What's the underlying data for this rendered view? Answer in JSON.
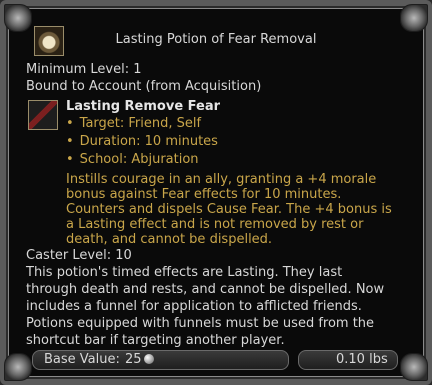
{
  "item": {
    "title": "Lasting Potion of Fear Removal",
    "minimum_level": "Minimum Level: 1",
    "binding": "Bound to Account (from Acquisition)",
    "icon": "potion-icon"
  },
  "spell": {
    "name": "Lasting Remove Fear",
    "icon": "remove-fear-icon",
    "bullets": [
      "Target: Friend, Self",
      "Duration: 10 minutes",
      "School: Abjuration"
    ],
    "description_lines": [
      "Instills courage in an ally, granting a +4 morale",
      "bonus against Fear effects for 10 minutes.",
      "Counters and dispels Cause Fear. The +4 bonus is",
      "a Lasting effect and is not removed by rest or",
      "death, and cannot be dispelled."
    ]
  },
  "caster_level": "Caster Level: 10",
  "info_lines": [
    "This potion's timed effects are Lasting. They last",
    "through death and rests, and cannot be dispelled. Now",
    "includes a funnel for application to afflicted friends.",
    "Potions equipped with funnels must be used from the",
    "shortcut bar if targeting another player."
  ],
  "footer": {
    "base_value_label": "Base Value:",
    "base_value": "25",
    "coin_icon": "silver-coin-icon",
    "weight": "0.10 lbs"
  }
}
